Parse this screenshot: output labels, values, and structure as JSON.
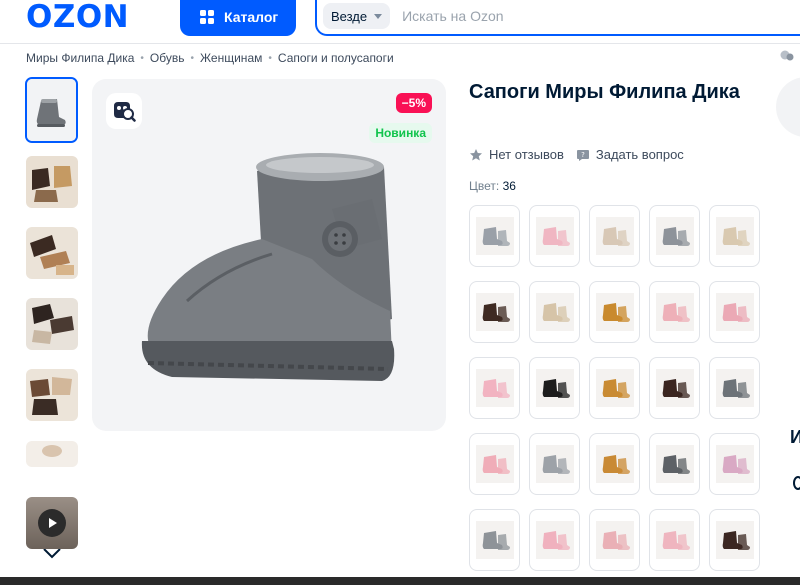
{
  "header": {
    "logo": "OZON",
    "catalog_label": "Каталог",
    "search_scope": "Везде",
    "search_placeholder": "Искать на Ozon"
  },
  "breadcrumbs": [
    "Миры Филипа Дика",
    "Обувь",
    "Женщинам",
    "Сапоги и полусапоги"
  ],
  "product": {
    "title": "Сапоги Миры Филипа Дика",
    "reviews_label": "Нет отзывов",
    "ask_label": "Задать вопрос",
    "color_label": "Цвет:",
    "color_value": "36",
    "discount_badge": "−5%",
    "new_badge": "Новинка"
  },
  "thumbnails": [
    {
      "tone": "grey",
      "icon": "grey-boot-image"
    },
    {
      "tone": "brown-tan",
      "icon": "brown-boots-image"
    },
    {
      "tone": "brown",
      "icon": "brown-boots-image"
    },
    {
      "tone": "dark",
      "icon": "dark-boots-image"
    },
    {
      "tone": "brown",
      "icon": "brown-boots-image"
    },
    {
      "tone": "light",
      "icon": "boot-image"
    }
  ],
  "swatches": [
    {
      "color": "#9aa0a8",
      "icon": "grey-boots"
    },
    {
      "color": "#f0b6c2",
      "icon": "pink-boots"
    },
    {
      "color": "#d8c8b6",
      "icon": "beige-boots"
    },
    {
      "color": "#8e939a",
      "icon": "grey-boots"
    },
    {
      "color": "#d9c9b0",
      "icon": "beige-boots"
    },
    {
      "color": "#3e2a22",
      "icon": "dark-brown-boots"
    },
    {
      "color": "#d6c4a8",
      "icon": "beige-boots"
    },
    {
      "color": "#c98a2e",
      "icon": "chestnut-boots"
    },
    {
      "color": "#eeb0b8",
      "icon": "pink-boots"
    },
    {
      "color": "#eba9b5",
      "icon": "pink-boots"
    },
    {
      "color": "#f2b3c1",
      "icon": "pink-boots"
    },
    {
      "color": "#1d1d1d",
      "icon": "black-boots"
    },
    {
      "color": "#c98b33",
      "icon": "chestnut-boots"
    },
    {
      "color": "#3a2520",
      "icon": "dark-brown-boots"
    },
    {
      "color": "#6d7378",
      "icon": "grey-boots"
    },
    {
      "color": "#f0adb8",
      "icon": "pink-boots"
    },
    {
      "color": "#9da2a8",
      "icon": "grey-boots"
    },
    {
      "color": "#c98a35",
      "icon": "chestnut-boots"
    },
    {
      "color": "#5d6166",
      "icon": "dark-grey-boots"
    },
    {
      "color": "#d9a9c4",
      "icon": "lilac-boots"
    },
    {
      "color": "#8e9398",
      "icon": "grey-boots"
    },
    {
      "color": "#f0b1be",
      "icon": "pink-boots"
    },
    {
      "color": "#eab0b6",
      "icon": "pink-boots"
    },
    {
      "color": "#efb5bf",
      "icon": "pink-boots"
    },
    {
      "color": "#3b2722",
      "icon": "dark-brown-boots"
    }
  ],
  "side_peek_letter": "И"
}
